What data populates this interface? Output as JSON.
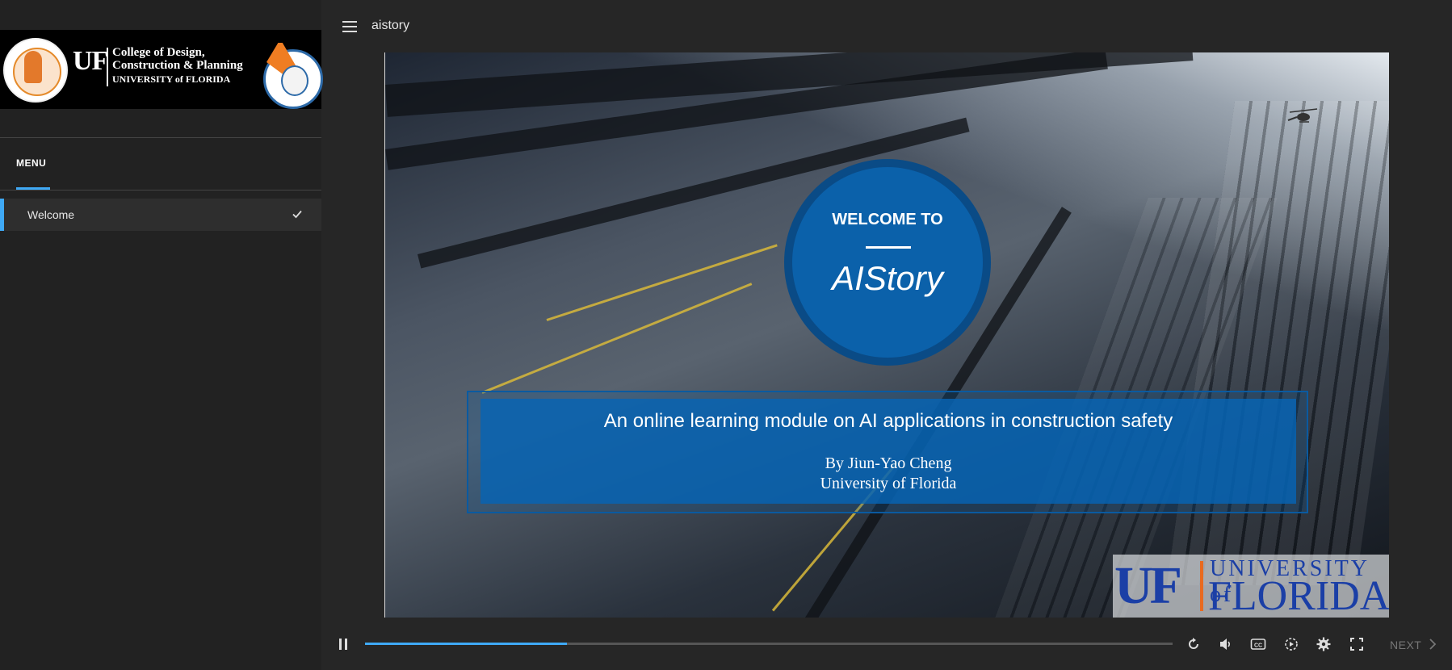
{
  "sidebar": {
    "logo": {
      "uf": "UF",
      "line1": "College of Design,",
      "line2": "Construction & Planning",
      "line3": "UNIVERSITY of FLORIDA"
    },
    "menu_label": "MENU",
    "items": [
      {
        "label": "Welcome",
        "completed": true
      }
    ]
  },
  "topbar": {
    "course_title": "aistory"
  },
  "slide": {
    "welcome_to": "WELCOME TO",
    "brand": "AIStory",
    "subtitle": "An online learning module on AI applications in construction safety",
    "author": "By Jiun-Yao Cheng",
    "organization": "University of Florida",
    "corner_logo": {
      "uf": "UF",
      "university": "UNIVERSITY of",
      "florida": "FLORIDA"
    }
  },
  "player": {
    "progress": 0.25,
    "next_label": "NEXT",
    "icons": [
      "pause-icon",
      "replay-icon",
      "volume-icon",
      "captions-icon",
      "playback-speed-icon",
      "settings-icon",
      "fullscreen-icon"
    ]
  },
  "colors": {
    "accent": "#3fa9f5",
    "slide_blue": "#0b61aa",
    "uf_blue": "#1b3fa6",
    "uf_orange": "#e86a1f"
  }
}
